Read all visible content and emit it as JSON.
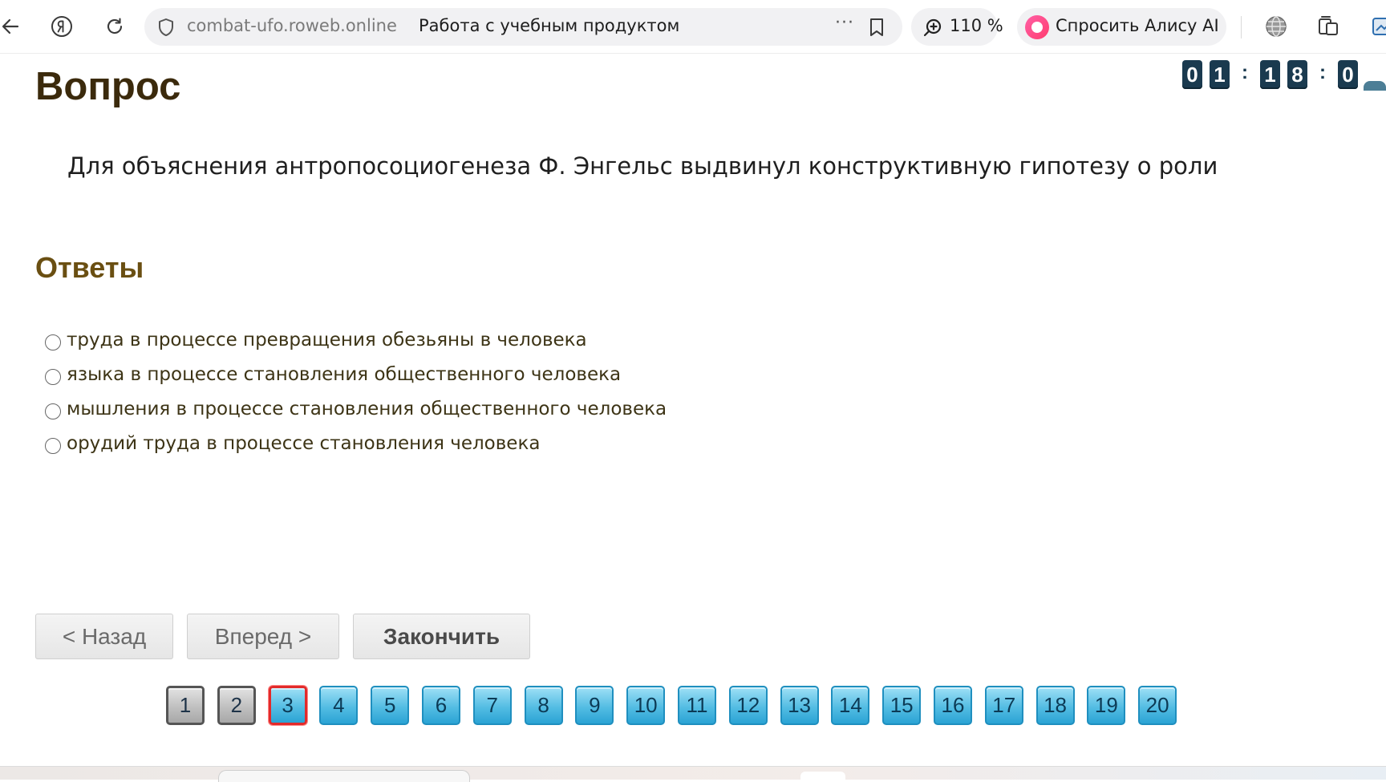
{
  "browser": {
    "url_host": "combat-ufo.roweb.online",
    "tab_title": "Работа с учебным продуктом",
    "more_label": "···",
    "zoom": "110 %",
    "alice_label": "Спросить Алису AI"
  },
  "page": {
    "heading": "Вопрос",
    "timer": {
      "digits": [
        "0",
        "1",
        "1",
        "8",
        "0"
      ],
      "separator": ":"
    },
    "question": "Для объяснения антропосоциогенеза Ф. Энгельс выдвинул конструктивную гипотезу о роли",
    "answers_heading": "Ответы",
    "answers": [
      "труда в процессе превращения обезьяны в человека",
      "языка в процессе становления общественного человека",
      "мышления в процессе становления общественного человека",
      "орудий труда в процессе становления человека"
    ],
    "buttons": {
      "back": "< Назад",
      "next": "Вперед >",
      "finish": "Закончить"
    },
    "pages": [
      "1",
      "2",
      "3",
      "4",
      "5",
      "6",
      "7",
      "8",
      "9",
      "10",
      "11",
      "12",
      "13",
      "14",
      "15",
      "16",
      "17",
      "18",
      "19",
      "20"
    ],
    "current_page": "3",
    "visited_pages": [
      "1",
      "2"
    ]
  }
}
